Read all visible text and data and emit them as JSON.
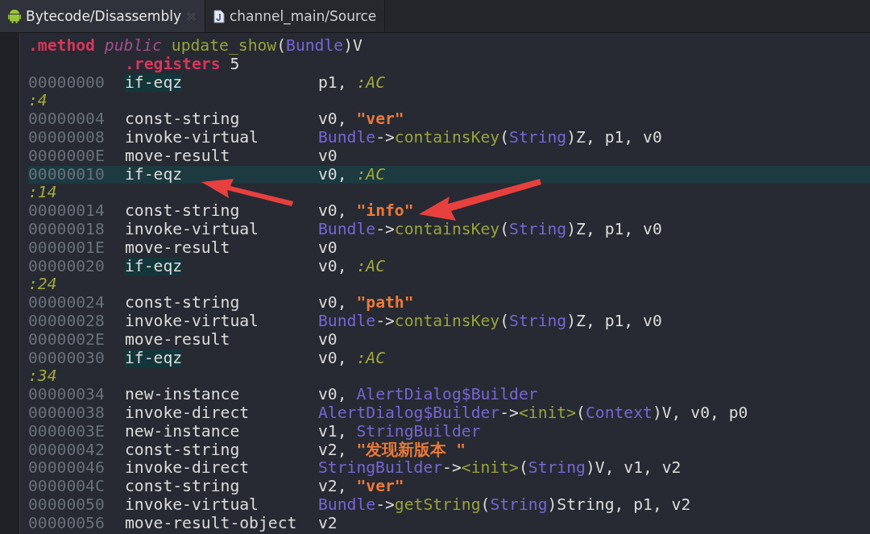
{
  "tabs": [
    {
      "label": "Bytecode/Disassembly",
      "kind": "android",
      "selected": true,
      "closable": true
    },
    {
      "label": "channel_main/Source",
      "kind": "java",
      "selected": false,
      "closable": false
    }
  ],
  "lines": [
    {
      "kind": "method",
      "tokens": [
        {
          "t": ".method ",
          "kind": "keyword"
        },
        {
          "t": "public ",
          "kind": "modifier"
        },
        {
          "t": "update_show",
          "kind": "name"
        },
        {
          "t": "(",
          "kind": "plain"
        },
        {
          "t": "Bundle",
          "kind": "type"
        },
        {
          "t": ")V",
          "kind": "plain"
        }
      ]
    },
    {
      "kind": "directive",
      "tokens": [
        {
          "t": ".registers",
          "kind": "keyword"
        },
        {
          "t": " 5",
          "kind": "plain"
        }
      ]
    },
    {
      "kind": "instr",
      "address": "00000000",
      "mnemonic": "if-eqz",
      "highlighted": true,
      "current": false,
      "tokens": [
        {
          "t": "p1, ",
          "kind": "plain"
        },
        {
          "t": ":AC",
          "kind": "label"
        }
      ]
    },
    {
      "kind": "label",
      "text": ":4"
    },
    {
      "kind": "instr",
      "address": "00000004",
      "mnemonic": "const-string",
      "highlighted": false,
      "current": false,
      "tokens": [
        {
          "t": "v0, ",
          "kind": "plain"
        },
        {
          "t": "\"ver\"",
          "kind": "string"
        }
      ]
    },
    {
      "kind": "instr",
      "address": "00000008",
      "mnemonic": "invoke-virtual",
      "highlighted": false,
      "current": false,
      "tokens": [
        {
          "t": "Bundle",
          "kind": "type"
        },
        {
          "t": "->",
          "kind": "plain"
        },
        {
          "t": "containsKey",
          "kind": "name"
        },
        {
          "t": "(",
          "kind": "plain"
        },
        {
          "t": "String",
          "kind": "type"
        },
        {
          "t": ")Z, p1, v0",
          "kind": "plain"
        }
      ]
    },
    {
      "kind": "instr",
      "address": "0000000E",
      "mnemonic": "move-result",
      "highlighted": false,
      "current": false,
      "tokens": [
        {
          "t": "v0",
          "kind": "plain"
        }
      ]
    },
    {
      "kind": "instr",
      "address": "00000010",
      "mnemonic": "if-eqz",
      "highlighted": false,
      "current": true,
      "tokens": [
        {
          "t": "v0, ",
          "kind": "plain"
        },
        {
          "t": ":AC",
          "kind": "label"
        }
      ]
    },
    {
      "kind": "label",
      "text": ":14"
    },
    {
      "kind": "instr",
      "address": "00000014",
      "mnemonic": "const-string",
      "highlighted": false,
      "current": false,
      "tokens": [
        {
          "t": "v0, ",
          "kind": "plain"
        },
        {
          "t": "\"info\"",
          "kind": "string"
        }
      ]
    },
    {
      "kind": "instr",
      "address": "00000018",
      "mnemonic": "invoke-virtual",
      "highlighted": false,
      "current": false,
      "tokens": [
        {
          "t": "Bundle",
          "kind": "type"
        },
        {
          "t": "->",
          "kind": "plain"
        },
        {
          "t": "containsKey",
          "kind": "name"
        },
        {
          "t": "(",
          "kind": "plain"
        },
        {
          "t": "String",
          "kind": "type"
        },
        {
          "t": ")Z, p1, v0",
          "kind": "plain"
        }
      ]
    },
    {
      "kind": "instr",
      "address": "0000001E",
      "mnemonic": "move-result",
      "highlighted": false,
      "current": false,
      "tokens": [
        {
          "t": "v0",
          "kind": "plain"
        }
      ]
    },
    {
      "kind": "instr",
      "address": "00000020",
      "mnemonic": "if-eqz",
      "highlighted": true,
      "current": false,
      "tokens": [
        {
          "t": "v0, ",
          "kind": "plain"
        },
        {
          "t": ":AC",
          "kind": "label"
        }
      ]
    },
    {
      "kind": "label",
      "text": ":24"
    },
    {
      "kind": "instr",
      "address": "00000024",
      "mnemonic": "const-string",
      "highlighted": false,
      "current": false,
      "tokens": [
        {
          "t": "v0, ",
          "kind": "plain"
        },
        {
          "t": "\"path\"",
          "kind": "string"
        }
      ]
    },
    {
      "kind": "instr",
      "address": "00000028",
      "mnemonic": "invoke-virtual",
      "highlighted": false,
      "current": false,
      "tokens": [
        {
          "t": "Bundle",
          "kind": "type"
        },
        {
          "t": "->",
          "kind": "plain"
        },
        {
          "t": "containsKey",
          "kind": "name"
        },
        {
          "t": "(",
          "kind": "plain"
        },
        {
          "t": "String",
          "kind": "type"
        },
        {
          "t": ")Z, p1, v0",
          "kind": "plain"
        }
      ]
    },
    {
      "kind": "instr",
      "address": "0000002E",
      "mnemonic": "move-result",
      "highlighted": false,
      "current": false,
      "tokens": [
        {
          "t": "v0",
          "kind": "plain"
        }
      ]
    },
    {
      "kind": "instr",
      "address": "00000030",
      "mnemonic": "if-eqz",
      "highlighted": true,
      "current": false,
      "tokens": [
        {
          "t": "v0, ",
          "kind": "plain"
        },
        {
          "t": ":AC",
          "kind": "label"
        }
      ]
    },
    {
      "kind": "label",
      "text": ":34"
    },
    {
      "kind": "instr",
      "address": "00000034",
      "mnemonic": "new-instance",
      "highlighted": false,
      "current": false,
      "tokens": [
        {
          "t": "v0, ",
          "kind": "plain"
        },
        {
          "t": "AlertDialog$Builder",
          "kind": "type"
        }
      ]
    },
    {
      "kind": "instr",
      "address": "00000038",
      "mnemonic": "invoke-direct",
      "highlighted": false,
      "current": false,
      "tokens": [
        {
          "t": "AlertDialog$Builder",
          "kind": "type"
        },
        {
          "t": "->",
          "kind": "plain"
        },
        {
          "t": "<init>",
          "kind": "name"
        },
        {
          "t": "(",
          "kind": "plain"
        },
        {
          "t": "Context",
          "kind": "type"
        },
        {
          "t": ")V, v0, p0",
          "kind": "plain"
        }
      ]
    },
    {
      "kind": "instr",
      "address": "0000003E",
      "mnemonic": "new-instance",
      "highlighted": false,
      "current": false,
      "tokens": [
        {
          "t": "v1, ",
          "kind": "plain"
        },
        {
          "t": "StringBuilder",
          "kind": "type"
        }
      ]
    },
    {
      "kind": "instr",
      "address": "00000042",
      "mnemonic": "const-string",
      "highlighted": false,
      "current": false,
      "tokens": [
        {
          "t": "v2, ",
          "kind": "plain"
        },
        {
          "t": "\"发现新版本 \"",
          "kind": "string"
        }
      ]
    },
    {
      "kind": "instr",
      "address": "00000046",
      "mnemonic": "invoke-direct",
      "highlighted": false,
      "current": false,
      "tokens": [
        {
          "t": "StringBuilder",
          "kind": "type"
        },
        {
          "t": "->",
          "kind": "plain"
        },
        {
          "t": "<init>",
          "kind": "name"
        },
        {
          "t": "(",
          "kind": "plain"
        },
        {
          "t": "String",
          "kind": "type"
        },
        {
          "t": ")V, v1, v2",
          "kind": "plain"
        }
      ]
    },
    {
      "kind": "instr",
      "address": "0000004C",
      "mnemonic": "const-string",
      "highlighted": false,
      "current": false,
      "tokens": [
        {
          "t": "v2, ",
          "kind": "plain"
        },
        {
          "t": "\"ver\"",
          "kind": "string"
        }
      ]
    },
    {
      "kind": "instr",
      "address": "00000050",
      "mnemonic": "invoke-virtual",
      "highlighted": false,
      "current": false,
      "tokens": [
        {
          "t": "Bundle",
          "kind": "type"
        },
        {
          "t": "->",
          "kind": "plain"
        },
        {
          "t": "getString",
          "kind": "name"
        },
        {
          "t": "(",
          "kind": "plain"
        },
        {
          "t": "String",
          "kind": "type"
        },
        {
          "t": ")String, p1, v2",
          "kind": "plain"
        }
      ]
    },
    {
      "kind": "instr",
      "address": "00000056",
      "mnemonic": "move-result-object",
      "highlighted": false,
      "current": false,
      "tokens": [
        {
          "t": "v2",
          "kind": "plain"
        }
      ]
    }
  ]
}
